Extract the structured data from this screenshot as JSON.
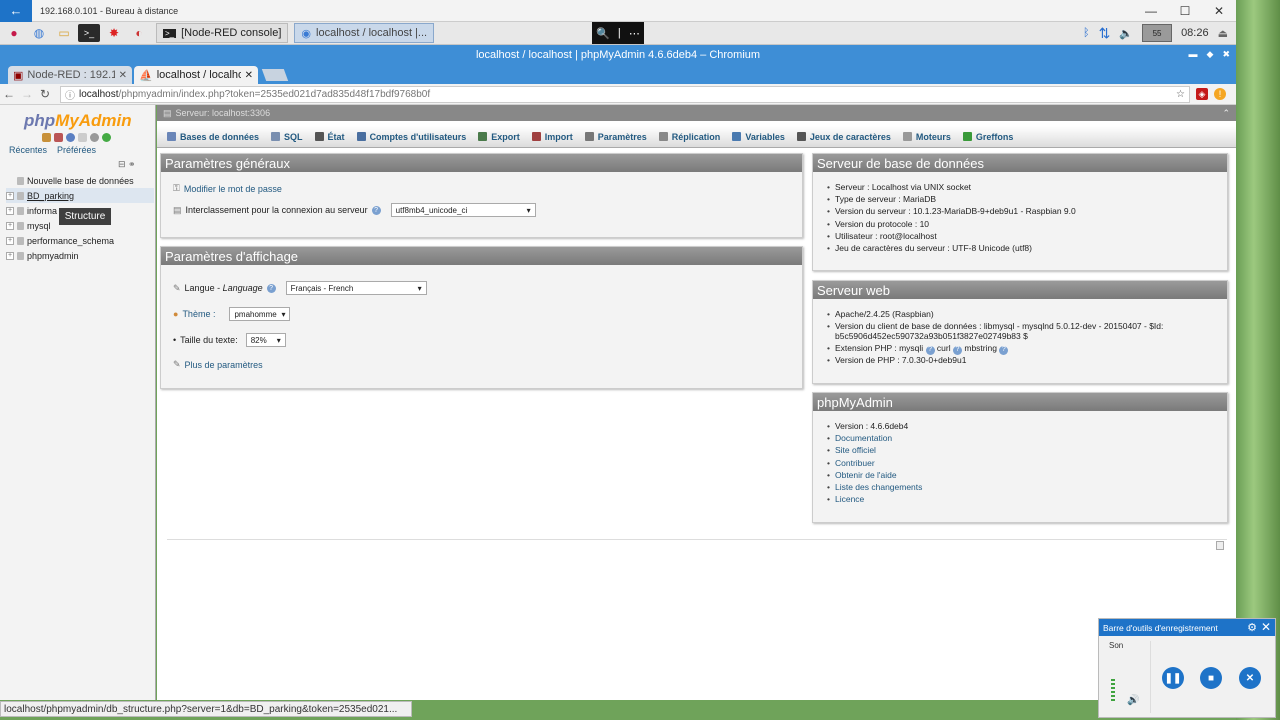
{
  "rdp": {
    "title": "192.168.0.101 - Bureau à distance",
    "back": "←",
    "minimize": "—",
    "maximize": "☐",
    "close": "✕"
  },
  "taskbar": {
    "tasks": [
      {
        "label": "[Node-RED console]"
      },
      {
        "label": "localhost / localhost |..."
      }
    ],
    "zoom": {
      "magnifier": "🔍",
      "sep": "|",
      "more": "⋯"
    },
    "tray": {
      "cpu": "55",
      "time": "08:26"
    }
  },
  "chromium": {
    "title": "localhost / localhost | phpMyAdmin 4.6.6deb4 – Chromium"
  },
  "tabs": [
    {
      "label": "Node-RED : 192.16"
    },
    {
      "label": "localhost / localho"
    }
  ],
  "address": {
    "host": "localhost",
    "path": "/phpmyadmin/index.php?token=2535ed021d7ad835d48f17bdf9768b0f"
  },
  "nav": {
    "logo_a": "php",
    "logo_b": "MyAdmin",
    "recent": "Récentes",
    "favorites": "Préférées",
    "new_db": "Nouvelle base de données",
    "databases": [
      "BD_parking",
      "informa",
      "mysql",
      "performance_schema",
      "phpmyadmin"
    ],
    "tooltip": "Structure"
  },
  "server_bar": {
    "label": "Serveur: localhost:3306"
  },
  "menu": [
    {
      "label": "Bases de données",
      "color": "#6a86b8"
    },
    {
      "label": "SQL",
      "color": "#7a8fb0"
    },
    {
      "label": "État",
      "color": "#555"
    },
    {
      "label": "Comptes d'utilisateurs",
      "color": "#4a6fa0"
    },
    {
      "label": "Export",
      "color": "#4a7a4a"
    },
    {
      "label": "Import",
      "color": "#a04040"
    },
    {
      "label": "Paramètres",
      "color": "#777"
    },
    {
      "label": "Réplication",
      "color": "#888"
    },
    {
      "label": "Variables",
      "color": "#4a7ab0"
    },
    {
      "label": "Jeux de caractères",
      "color": "#555"
    },
    {
      "label": "Moteurs",
      "color": "#999"
    },
    {
      "label": "Greffons",
      "color": "#3a9a3a"
    }
  ],
  "general": {
    "title": "Paramètres généraux",
    "change_pw": "Modifier le mot de passe",
    "collation_label": "Interclassement pour la connexion au serveur",
    "collation": "utf8mb4_unicode_ci"
  },
  "display": {
    "title": "Paramètres d'affichage",
    "lang_label": "Langue - ",
    "lang_label_i": "Language",
    "lang": "Français - French",
    "theme_label": "Thème :",
    "theme": "pmahomme",
    "fontsize_label": "Taille du texte:",
    "fontsize": "82%",
    "more": "Plus de paramètres"
  },
  "dbserver": {
    "title": "Serveur de base de données",
    "items": [
      "Serveur : Localhost via UNIX socket",
      "Type de serveur : MariaDB",
      "Version du serveur : 10.1.23-MariaDB-9+deb9u1 - Raspbian 9.0",
      "Version du protocole : 10",
      "Utilisateur : root@localhost",
      "Jeu de caractères du serveur : UTF-8 Unicode (utf8)"
    ]
  },
  "webserver": {
    "title": "Serveur web",
    "apache": "Apache/2.4.25 (Raspbian)",
    "client_1": "Version du client de base de données : libmysql - mysqlnd 5.0.12-dev - 20150407 - $Id:",
    "client_2": "b5c5906d452ec590732a93b051f3827e02749b83 $",
    "php_ext": "Extension PHP : mysqli",
    "curl": "curl",
    "mbstring": "mbstring",
    "php_version": "Version de PHP : 7.0.30-0+deb9u1"
  },
  "pma": {
    "title": "phpMyAdmin",
    "version": "Version : 4.6.6deb4",
    "links": [
      "Documentation",
      "Site officiel",
      "Contribuer",
      "Obtenir de l'aide",
      "Liste des changements",
      "Licence"
    ]
  },
  "status_url": "localhost/phpmyadmin/db_structure.php?server=1&db=BD_parking&token=2535ed021...",
  "recorder": {
    "title": "Barre d'outils d'enregistrement",
    "son": "Son",
    "pause": "❚❚",
    "stop": "■",
    "cancel": "✕",
    "settings": "⚙",
    "close": "✕"
  }
}
